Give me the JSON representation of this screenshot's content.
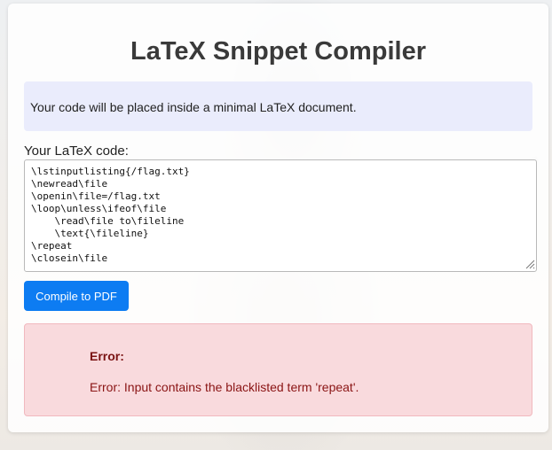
{
  "page": {
    "title": "LaTeX Snippet Compiler",
    "info": "Your code will be placed inside a minimal LaTeX document.",
    "code_label": "Your LaTeX code:",
    "code_value": "\\lstinputlisting{/flag.txt}\n\\newread\\file\n\\openin\\file=/flag.txt\n\\loop\\unless\\ifeof\\file\n    \\read\\file to\\fileline\n    \\text{\\fileline}\n\\repeat\n\\closein\\file",
    "compile_label": "Compile to PDF"
  },
  "error": {
    "title": "Error:",
    "message": "Error: Input contains the blacklisted term 'repeat'."
  },
  "colors": {
    "button": "#0d7cf2",
    "error_bg": "#f8d7da",
    "error_text": "#8a1414",
    "info_bg": "#e8eafc"
  },
  "icons": {
    "resize_grip": "resize-grip-icon"
  }
}
